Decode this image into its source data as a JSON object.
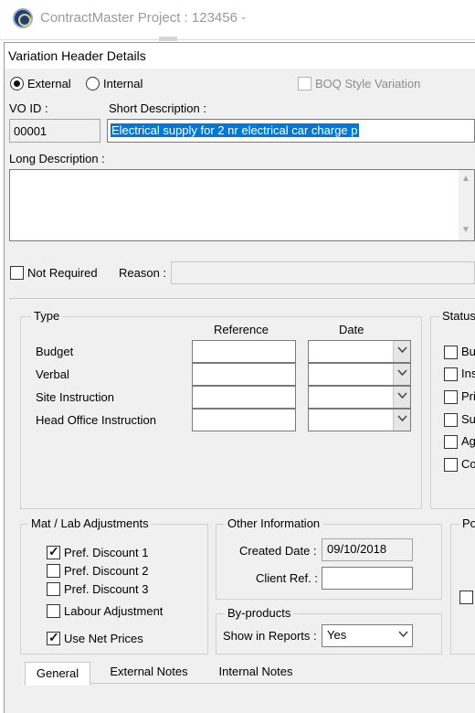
{
  "window": {
    "app_title": "ContractMaster Project : 123456 -",
    "form_title": "Variation Header Details"
  },
  "header": {
    "external_label": "External",
    "internal_label": "Internal",
    "boq_label": "BOQ Style Variation",
    "vo_id_label": "VO ID :",
    "vo_id_value": "00001",
    "short_desc_label": "Short Description :",
    "short_desc_value": "Electrical supply for 2 nr electrical car charge p",
    "long_desc_label": "Long Description :",
    "long_desc_value": "",
    "not_required_label": "Not Required",
    "reason_label": "Reason :",
    "reason_value": ""
  },
  "type_group": {
    "title": "Type",
    "reference_header": "Reference",
    "date_header": "Date",
    "rows": [
      {
        "label": "Budget",
        "reference": "",
        "date": ""
      },
      {
        "label": "Verbal",
        "reference": "",
        "date": ""
      },
      {
        "label": "Site Instruction",
        "reference": "",
        "date": ""
      },
      {
        "label": "Head Office Instruction",
        "reference": "",
        "date": ""
      }
    ]
  },
  "status_group": {
    "title": "Status",
    "items": [
      "Bu",
      "Ins",
      "Pri",
      "Su",
      "Ag",
      "Co"
    ]
  },
  "adjustments": {
    "title": "Mat / Lab Adjustments",
    "items": [
      {
        "label": "Pref. Discount 1",
        "checked": true
      },
      {
        "label": "Pref. Discount 2",
        "checked": false
      },
      {
        "label": "Pref. Discount 3",
        "checked": false
      },
      {
        "label": "Labour Adjustment",
        "checked": false
      },
      {
        "label": "Use Net Prices",
        "checked": true
      }
    ]
  },
  "other_info": {
    "title": "Other Information",
    "created_date_label": "Created Date :",
    "created_date_value": "09/10/2018",
    "client_ref_label": "Client Ref. :",
    "client_ref_value": ""
  },
  "byproducts": {
    "title": "By-products",
    "show_in_reports_label": "Show in Reports :",
    "show_in_reports_value": "Yes"
  },
  "partial_group": {
    "title": "Po"
  },
  "tabs": [
    {
      "label": "General",
      "active": true
    },
    {
      "label": "External Notes",
      "active": false
    },
    {
      "label": "Internal Notes",
      "active": false
    }
  ]
}
